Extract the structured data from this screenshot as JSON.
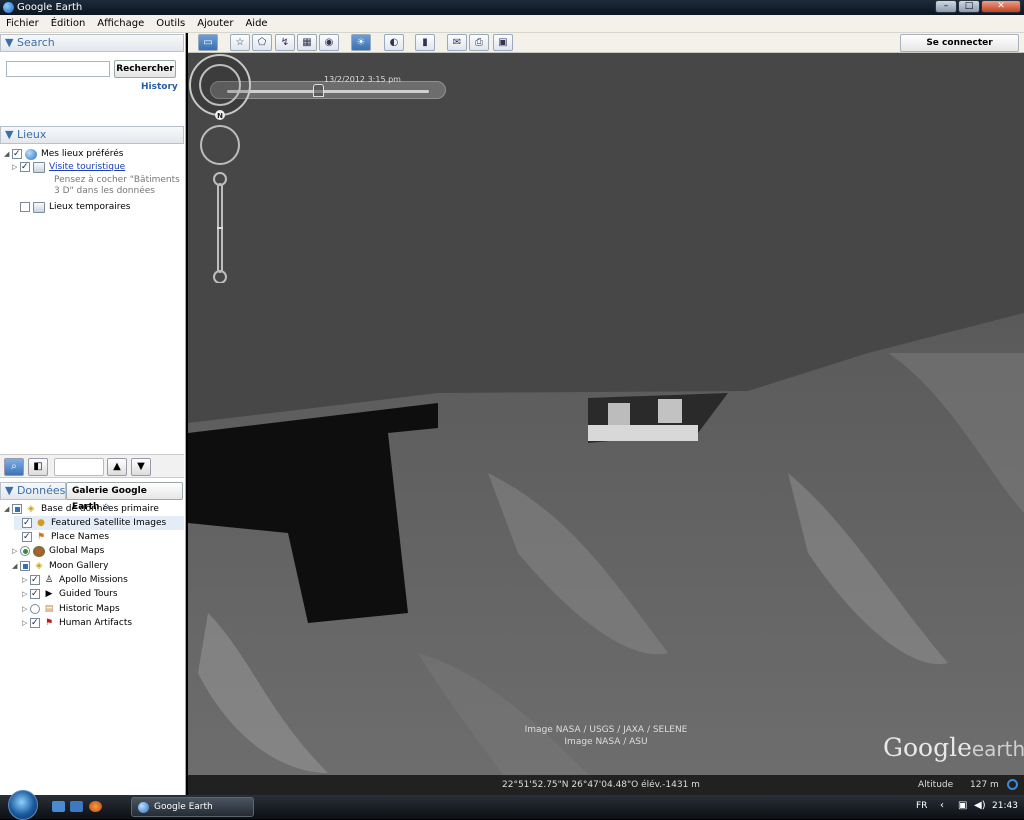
{
  "window": {
    "title": "Google Earth"
  },
  "menu": [
    "Fichier",
    "Édition",
    "Affichage",
    "Outils",
    "Ajouter",
    "Aide"
  ],
  "toolbar": {
    "signin_label": "Se connecter"
  },
  "search": {
    "header": "▼ Search",
    "button_label": "Rechercher",
    "history_label": "History",
    "input_value": ""
  },
  "places": {
    "header": "▼ Lieux",
    "items": {
      "favorites": "Mes lieux préférés",
      "tour": "Visite touristique",
      "tour_hint_1": "Pensez à cocher \"Bâtiments",
      "tour_hint_2": "3 D\" dans les données",
      "temp": "Lieux temporaires"
    }
  },
  "layers": {
    "header": "▼ Données",
    "gallery_label": "Galerie Google Earth",
    "items": {
      "primary_db": "Base de données primaire",
      "featured": "Featured Satellite Images",
      "place_names": "Place Names",
      "global_maps": "Global Maps",
      "moon_gallery": "Moon Gallery",
      "apollo": "Apollo Missions",
      "guided": "Guided Tours",
      "historic": "Historic Maps",
      "artifacts": "Human Artifacts"
    }
  },
  "map": {
    "time_label": "13/2/2012   3:15 pm",
    "time_position": 0.5,
    "attribution_1": "Image NASA / USGS / JAXA / SELENE",
    "attribution_2": "Image NASA / ASU",
    "logo_google": "Google",
    "logo_earth": "earth",
    "coords": "22°51'52.75\"N  26°47'04.48\"O élév.-1431 m",
    "altitude_label": "Altitude",
    "altitude_value": "127 m",
    "compass_label": "N"
  },
  "taskbar": {
    "app_label": "Google Earth",
    "lang": "FR",
    "time": "21:43"
  },
  "colors": {
    "accent": "#3a6fa8",
    "map_bg": "#474747"
  }
}
